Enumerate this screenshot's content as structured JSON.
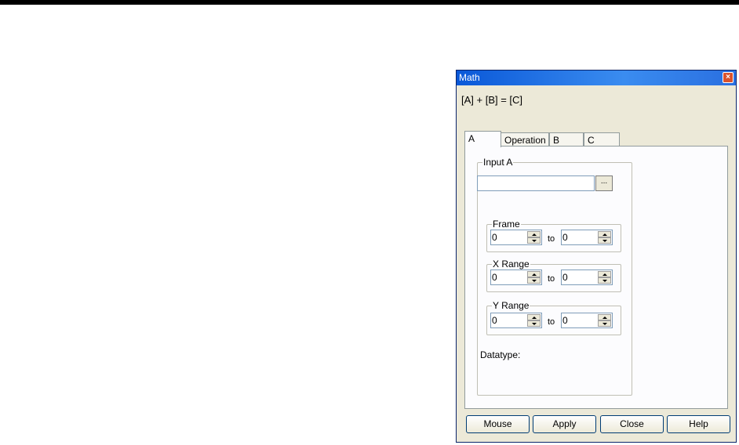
{
  "window": {
    "title": "Math",
    "close_glyph": "×"
  },
  "formula": "[A] + [B] = [C]",
  "tabs": [
    {
      "label": "A",
      "active": true
    },
    {
      "label": "Operation",
      "active": false
    },
    {
      "label": "B",
      "active": false
    },
    {
      "label": "C",
      "active": false
    }
  ],
  "input_group": {
    "label": "Input A",
    "path_value": "",
    "browse_label": "..."
  },
  "ranges": {
    "to_label": "to",
    "frame": {
      "label": "Frame",
      "from": "0",
      "to": "0"
    },
    "x_range": {
      "label": "X Range",
      "from": "0",
      "to": "0"
    },
    "y_range": {
      "label": "Y Range",
      "from": "0",
      "to": "0"
    }
  },
  "datatype_label": "Datatype:",
  "buttons": {
    "mouse": "Mouse",
    "apply": "Apply",
    "close": "Close",
    "help": "Help"
  },
  "colors": {
    "titlebar": "#0a58d8",
    "dialog_bg": "#ece9d8",
    "panel_bg": "#fcfcfe",
    "close_button": "#d9522c"
  },
  "icons": {
    "close": "close-icon",
    "spin_up": "arrow-up-icon",
    "spin_down": "arrow-down-icon"
  }
}
